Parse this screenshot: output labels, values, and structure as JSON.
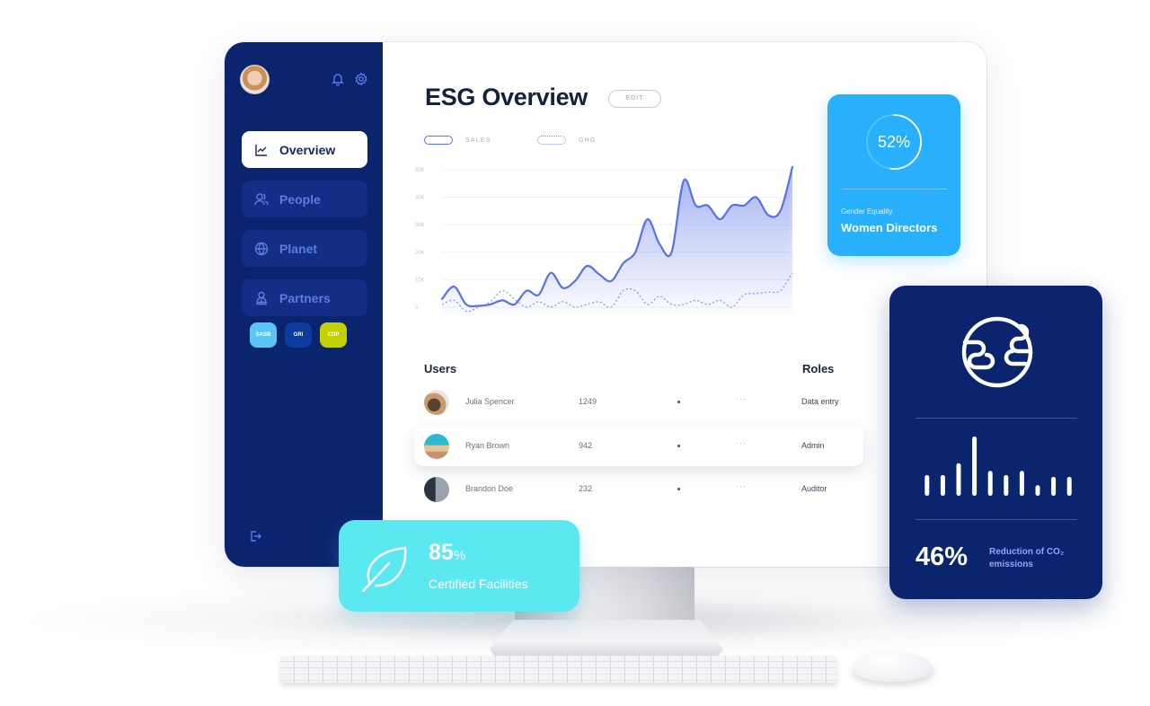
{
  "sidebar": {
    "nav": [
      {
        "label": "Overview",
        "icon": "line-chart-icon",
        "active": true
      },
      {
        "label": "People",
        "icon": "people-icon",
        "active": false
      },
      {
        "label": "Planet",
        "icon": "globe-icon",
        "active": false
      },
      {
        "label": "Partners",
        "icon": "partner-icon",
        "active": false
      }
    ],
    "badges": [
      {
        "label": "SASB",
        "color": "#5bc6f5"
      },
      {
        "label": "GRI",
        "color": "#0d3a9e"
      },
      {
        "label": "CDP",
        "color": "#c2d100"
      }
    ],
    "top_icons": [
      "bell-icon",
      "gear-icon"
    ],
    "bottom_icon": "logout-icon"
  },
  "header": {
    "title": "ESG Overview",
    "edit_label": "EDIT"
  },
  "legend": {
    "sales": "SALES",
    "ghg": "GHG"
  },
  "chart_data": {
    "type": "line",
    "title": "",
    "xlabel": "",
    "ylabel": "",
    "ylim": [
      0,
      50000
    ],
    "y_ticks": [
      "0",
      "10K",
      "20K",
      "30K",
      "40K",
      "50K"
    ],
    "grid": true,
    "legend_position": "top-left",
    "x": [
      0,
      1,
      2,
      3,
      4,
      5,
      6,
      7,
      8,
      9,
      10,
      11,
      12,
      13,
      14,
      15,
      16,
      17,
      18,
      19,
      20,
      21,
      22,
      23,
      24,
      25,
      26,
      27,
      28
    ],
    "series": [
      {
        "name": "SALES",
        "style": "solid",
        "color": "#5872e8",
        "values": [
          3000,
          7500,
          1000,
          500,
          1000,
          2500,
          1000,
          6000,
          4500,
          12500,
          7000,
          9500,
          15000,
          12000,
          9500,
          16000,
          20000,
          32000,
          23000,
          20000,
          46000,
          37000,
          37000,
          32000,
          37000,
          37000,
          40000,
          33500,
          35000,
          51000
        ]
      },
      {
        "name": "GHG",
        "style": "dotted",
        "color": "#7e93ee",
        "values": [
          1000,
          2500,
          -1500,
          0,
          2000,
          6000,
          3000,
          0,
          2000,
          0,
          2000,
          0,
          1000,
          2000,
          0,
          6000,
          6000,
          1000,
          4000,
          1000,
          1000,
          2500,
          1000,
          2500,
          0,
          4500,
          5000,
          5500,
          6000,
          12500
        ]
      }
    ]
  },
  "users": {
    "heading": "Users",
    "roles_heading": "Roles",
    "rows": [
      {
        "name": "Julia Spencer",
        "count": "1249",
        "more": "···",
        "role": "Data entry",
        "highlight": false
      },
      {
        "name": "Ryan Brown",
        "count": "942",
        "more": "···",
        "role": "Admin",
        "highlight": true
      },
      {
        "name": "Brandon Doe",
        "count": "232",
        "more": "···",
        "role": "Auditor",
        "highlight": false
      }
    ]
  },
  "gender_card": {
    "percent": "52%",
    "progress": 0.52,
    "subtitle": "Gender Equality",
    "title": "Women Directors"
  },
  "co2_card": {
    "icon": "earth-icon",
    "bars": [
      0.35,
      0.35,
      0.55,
      1.0,
      0.42,
      0.35,
      0.42,
      0.18,
      0.32,
      0.32
    ],
    "percent": "46%",
    "desc_line1": "Reduction of CO₂",
    "desc_line2": "emissions"
  },
  "facilities_card": {
    "icon": "leaf-icon",
    "value": "85",
    "unit": "%",
    "label": "Certified Facilities"
  }
}
